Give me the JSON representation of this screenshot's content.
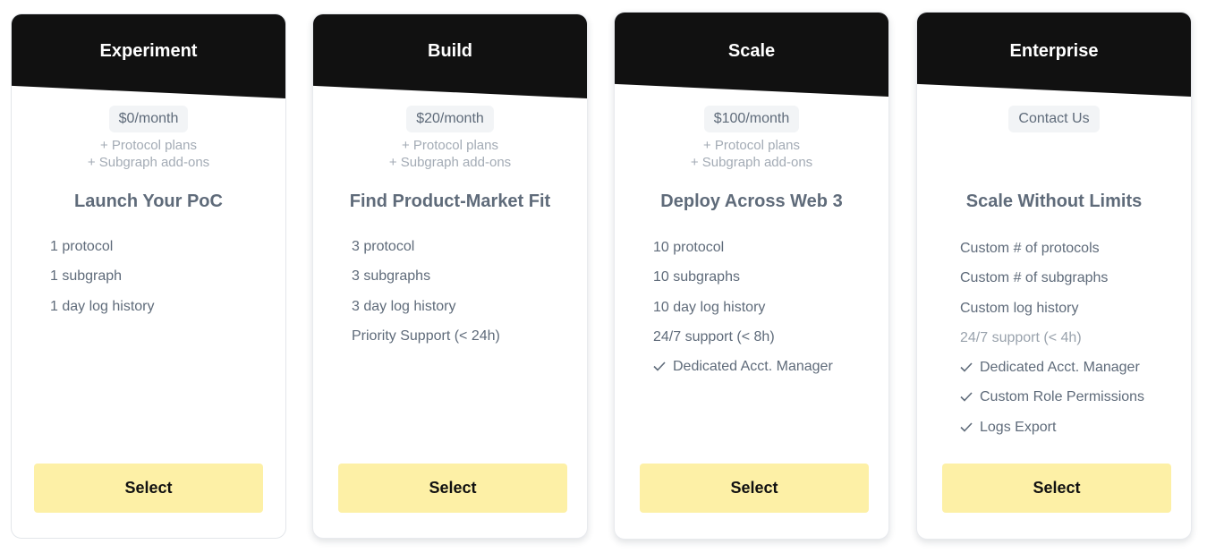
{
  "plans": [
    {
      "title": "Experiment",
      "price": "$0/month",
      "addons": [
        "+ Protocol plans",
        "+ Subgraph add-ons"
      ],
      "tagline": "Launch Your PoC",
      "features": [
        {
          "text": "1 protocol"
        },
        {
          "text": "1 subgraph"
        },
        {
          "text": "1 day log history"
        }
      ],
      "button": "Select"
    },
    {
      "title": "Build",
      "price": "$20/month",
      "addons": [
        "+ Protocol plans",
        "+ Subgraph add-ons"
      ],
      "tagline": "Find Product-Market Fit",
      "features": [
        {
          "text": "3 protocol"
        },
        {
          "text": "3 subgraphs"
        },
        {
          "text": "3 day log history"
        },
        {
          "text": "Priority Support (< 24h)"
        }
      ],
      "button": "Select"
    },
    {
      "title": "Scale",
      "price": "$100/month",
      "addons": [
        "+ Protocol plans",
        "+ Subgraph add-ons"
      ],
      "tagline": "Deploy Across Web 3",
      "features": [
        {
          "text": "10 protocol"
        },
        {
          "text": "10 subgraphs"
        },
        {
          "text": "10 day log history"
        },
        {
          "text": "24/7 support (< 8h)"
        },
        {
          "text": "Dedicated Acct. Manager",
          "icon": "check-icon"
        }
      ],
      "button": "Select"
    },
    {
      "title": "Enterprise",
      "price": "Contact Us",
      "addons": [],
      "tagline": "Scale Without Limits",
      "features": [
        {
          "text": "Custom # of protocols"
        },
        {
          "text": "Custom # of subgraphs"
        },
        {
          "text": "Custom log history"
        },
        {
          "text": "24/7 support (< 4h)",
          "muted": true
        },
        {
          "text": "Dedicated Acct. Manager",
          "icon": "check-icon"
        },
        {
          "text": "Custom Role Permissions",
          "icon": "check-icon"
        },
        {
          "text": "Logs Export",
          "icon": "check-icon"
        }
      ],
      "button": "Select"
    }
  ],
  "colors": {
    "header_bg": "#111111",
    "button_bg": "#fdf0a6",
    "text": "#5f6b7a",
    "muted_text": "#a3abb5"
  }
}
